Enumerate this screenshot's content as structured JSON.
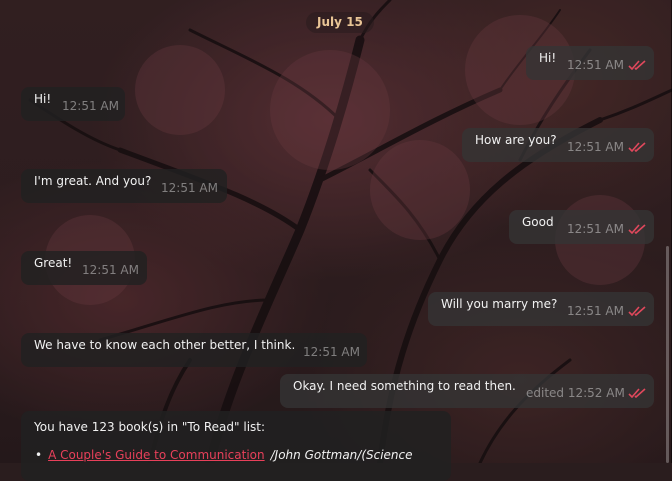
{
  "chat": {
    "date": "July 15",
    "messages": [
      {
        "dir": "out",
        "text": "Hi!",
        "time": "12:51 AM"
      },
      {
        "dir": "in",
        "text": "Hi!",
        "time": "12:51 AM"
      },
      {
        "dir": "out",
        "text": "How are you?",
        "time": "12:51 AM"
      },
      {
        "dir": "in",
        "text": "I'm great. And you?",
        "time": "12:51 AM"
      },
      {
        "dir": "out",
        "text": "Good",
        "time": "12:51 AM"
      },
      {
        "dir": "in",
        "text": "Great!",
        "time": "12:51 AM"
      },
      {
        "dir": "out",
        "text": "Will you marry me?",
        "time": "12:51 AM"
      },
      {
        "dir": "in",
        "text": "We have to know each other better, I think.",
        "time": "12:51 AM"
      },
      {
        "dir": "out",
        "text": "Okay. I need something to read then.",
        "time": "edited 12:52 AM"
      }
    ],
    "book_message": {
      "text": "You have 123 book(s) in \"To Read\" list:",
      "bullet": "•",
      "first_book_title": "A Couple's Guide to Communication",
      "first_book_author": "/John Gottman/(Science"
    }
  },
  "icons": {
    "read_receipt": "double-check-icon"
  },
  "colors": {
    "check": "#e0485c",
    "date": "#e9c596",
    "link": "#e8405a"
  }
}
